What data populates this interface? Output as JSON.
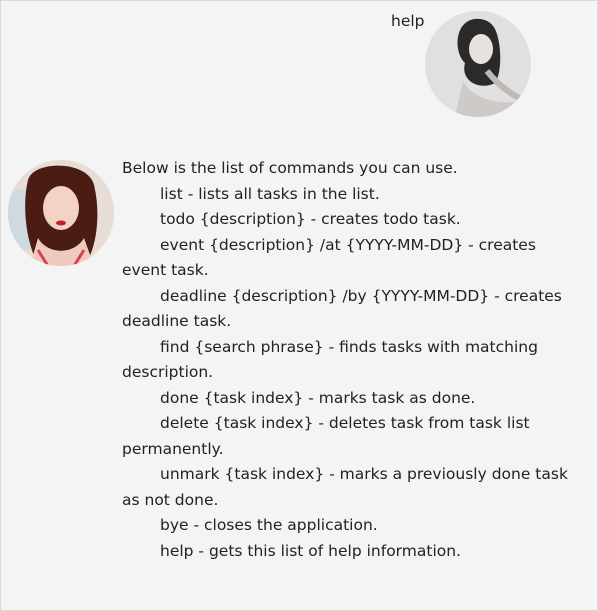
{
  "user_message": {
    "text": "help",
    "avatar_icon": "user-avatar-photo"
  },
  "bot_message": {
    "avatar_icon": "bot-avatar-photo",
    "intro": "Below is the list of commands you can use.",
    "commands": [
      "list - lists all tasks in the list.",
      "todo {description} - creates todo task.",
      "event {description} /at {YYYY-MM-DD} - creates event task.",
      "deadline {description} /by {YYYY-MM-DD} - creates deadline task.",
      "find {search phrase} - finds tasks with matching description.",
      "done {task index} - marks task as done.",
      "delete {task index} - deletes task from task list permanently.",
      "unmark {task index} - marks a previously done task as not done.",
      "bye - closes the application.",
      "help - gets this list of help information."
    ]
  }
}
